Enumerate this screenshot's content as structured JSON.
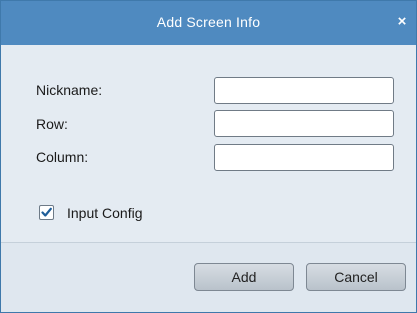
{
  "dialog": {
    "title": "Add Screen Info",
    "close_icon": "close-icon",
    "close_glyph": "×"
  },
  "form": {
    "nickname_label": "Nickname:",
    "nickname_value": "",
    "row_label": "Row:",
    "row_value": "",
    "column_label": "Column:",
    "column_value": ""
  },
  "input_config": {
    "label": "Input Config",
    "checked": true
  },
  "buttons": {
    "add_label": "Add",
    "cancel_label": "Cancel"
  },
  "colors": {
    "titlebar": "#4f8ac0",
    "body": "#e4ebf2",
    "checkmark": "#1f5e99"
  }
}
